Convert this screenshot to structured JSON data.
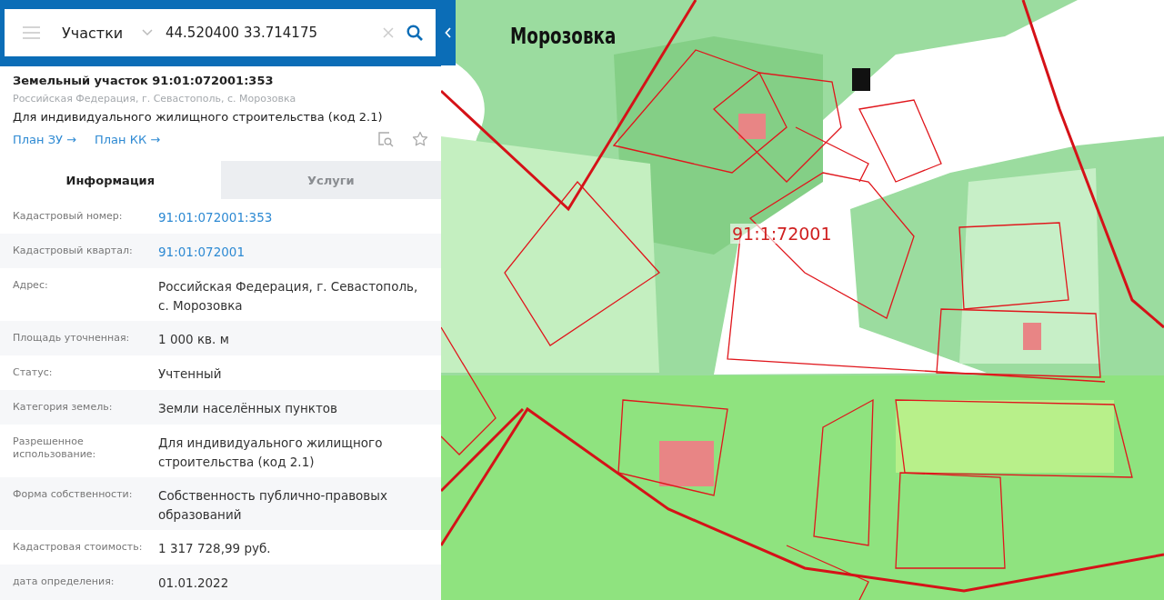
{
  "search": {
    "layer": "Участки",
    "query": "44.520400 33.714175"
  },
  "parcel": {
    "title": "Земельный участок 91:01:072001:353",
    "address": "Российская Федерация, г. Севастополь, с. Морозовка",
    "purpose": "Для индивидуального жилищного строительства (код 2.1)",
    "links": [
      "План ЗУ →",
      "План КК →"
    ]
  },
  "tabs": [
    {
      "label": "Информация",
      "selected": true
    },
    {
      "label": "Услуги",
      "selected": false
    }
  ],
  "details": [
    {
      "label": "Кадастровый номер:",
      "value": "91:01:072001:353",
      "kind": "link"
    },
    {
      "label": "Кадастровый квартал:",
      "value": "91:01:072001",
      "kind": "link"
    },
    {
      "label": "Адрес:",
      "value": "Российская Федерация, г. Севастополь, с. Морозовка",
      "kind": "text"
    },
    {
      "label": "Площадь уточненная:",
      "value": "1 000 кв. м",
      "kind": "text"
    },
    {
      "label": "Статус:",
      "value": "Учтенный",
      "kind": "text"
    },
    {
      "label": "Категория земель:",
      "value": "Земли населённых пунктов",
      "kind": "text"
    },
    {
      "label": "Разрешенное использование:",
      "value": "Для индивидуального жилищного строительства (код 2.1)",
      "kind": "text"
    },
    {
      "label": "Форма собственности:",
      "value": "Собственность публично-правовых образований",
      "kind": "text"
    },
    {
      "label": "Кадастровая стоимость:",
      "value": "1 317 728,99 руб.",
      "kind": "text"
    },
    {
      "label": "дата определения:",
      "value": "01.01.2022",
      "kind": "text"
    }
  ],
  "map": {
    "labels": [
      {
        "text": "Морозовка",
        "kind": "place"
      },
      {
        "text": "91:1:72001",
        "kind": "quarter"
      }
    ]
  }
}
